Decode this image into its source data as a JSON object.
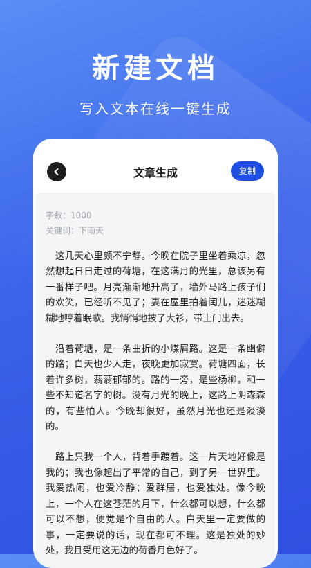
{
  "hero": {
    "title": "新建文档",
    "subtitle": "写入文本在线一键生成"
  },
  "toolbar": {
    "title": "文章生成",
    "back_icon": "chevron-left-icon",
    "copy_label": "复制"
  },
  "colors": {
    "accent": "#1f4fe0",
    "bg_gradient_start": "#5a8ef5",
    "bg_gradient_end": "#2f4fe0"
  },
  "meta": {
    "word_count": "字数：1000",
    "keywords": "关键词：下雨天"
  },
  "article": {
    "paragraphs": [
      "这几天心里颇不宁静。今晚在院子里坐着乘凉，忽然想起日日走过的荷塘，在这满月的光里，总该另有一番样子吧。月亮渐渐地升高了，墙外马路上孩子们的欢笑，已经听不见了；妻在屋里拍着闰儿，迷迷糊糊地哼着眠歌。我悄悄地披了大衫，带上门出去。",
      "沿着荷塘，是一条曲折的小煤屑路。这是一条幽僻的路；白天也少人走，夜晚更加寂寞。荷塘四面，长着许多树，蓊蓊郁郁的。路的一旁，是些杨柳，和一些不知道名字的树。没有月光的晚上，这路上阴森森的，有些怕人。今晚却很好，虽然月光也还是淡淡的。",
      "路上只我一个人，背着手踱着。这一片天地好像是我的；我也像超出了平常的自己，到了另一世界里。我爱热闹，也爱冷静；爱群居，也爱独处。像今晚上，一个人在这苍茫的月下，什么都可以想，什么都可以不想，便觉是个自由的人。白天里一定要做的事，一定要说的话，现在都可不理。这是独处的妙处，我且受用这无边的荷香月色好了。"
    ]
  }
}
